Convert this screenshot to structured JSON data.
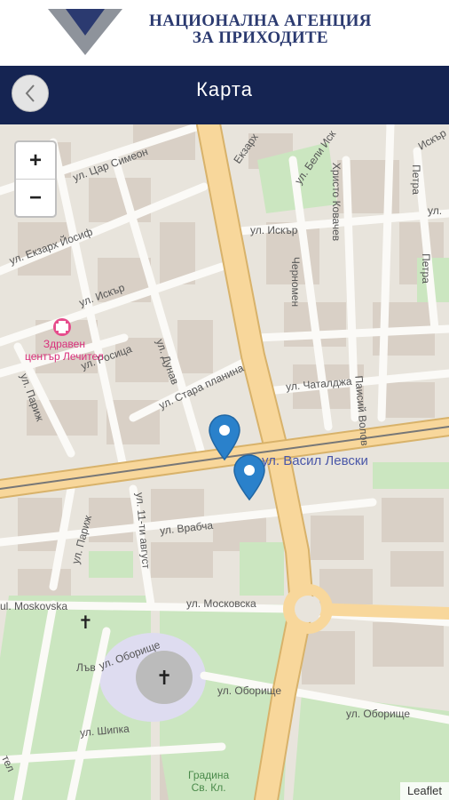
{
  "header": {
    "logo_line1": "НАЦИОНАЛНА АГЕНЦИЯ",
    "logo_line2": "ЗА ПРИХОДИТЕ",
    "colors": {
      "brand": "#2b3a70",
      "bar": "#152452"
    }
  },
  "titlebar": {
    "title": "Карта",
    "back_icon": "chevron-left-icon"
  },
  "map": {
    "zoom_in": "+",
    "zoom_out": "−",
    "attribution": "Leaflet",
    "labels": {
      "tsar_simeon": "ул. Цар Симеон",
      "ekzarh_yosif": "ул. Екзарх Йосиф",
      "iskar_left": "ул. Искър",
      "rositsa": "ул. Росица",
      "dunav": "ул. Дунав",
      "stara_planina": "ул. Стара планина",
      "parizh": "ул. Париж",
      "health_center": "Здравен\nцентър Лечител",
      "ekzarh_right": "Екзарх",
      "beli_iskar": "ул. Бели Иск",
      "hristo_kovachev": "Христо Ковачев",
      "iskar_right": "ул. Искър",
      "chernomen": "Черномен",
      "petra1": "Петра",
      "petra2": "Петра",
      "iskar_top": "Искър",
      "ul_ri": "ул.",
      "chatalzha": "ул. Чаталджа",
      "paisiy": "Паисий Волов",
      "vasil_levski": "ул. Васил Левски",
      "vrabcha": "ул. Врабча",
      "11_avgust": "ул. 11-ти август",
      "parizh2": "ул. Париж",
      "moskovska_left": "ul. Moskovska",
      "moskovska": "ул. Московска",
      "oborishte_left": "ул. Оборище",
      "oborishte_mid": "ул. Оборище",
      "oborishte_right": "ул. Оборище",
      "lav": "Лъв",
      "shipka": "ул. Шипка",
      "gradina": "Градина\nСв. Кл.",
      "tel": "тел"
    },
    "markers": [
      "location-marker-1",
      "location-marker-2"
    ]
  }
}
